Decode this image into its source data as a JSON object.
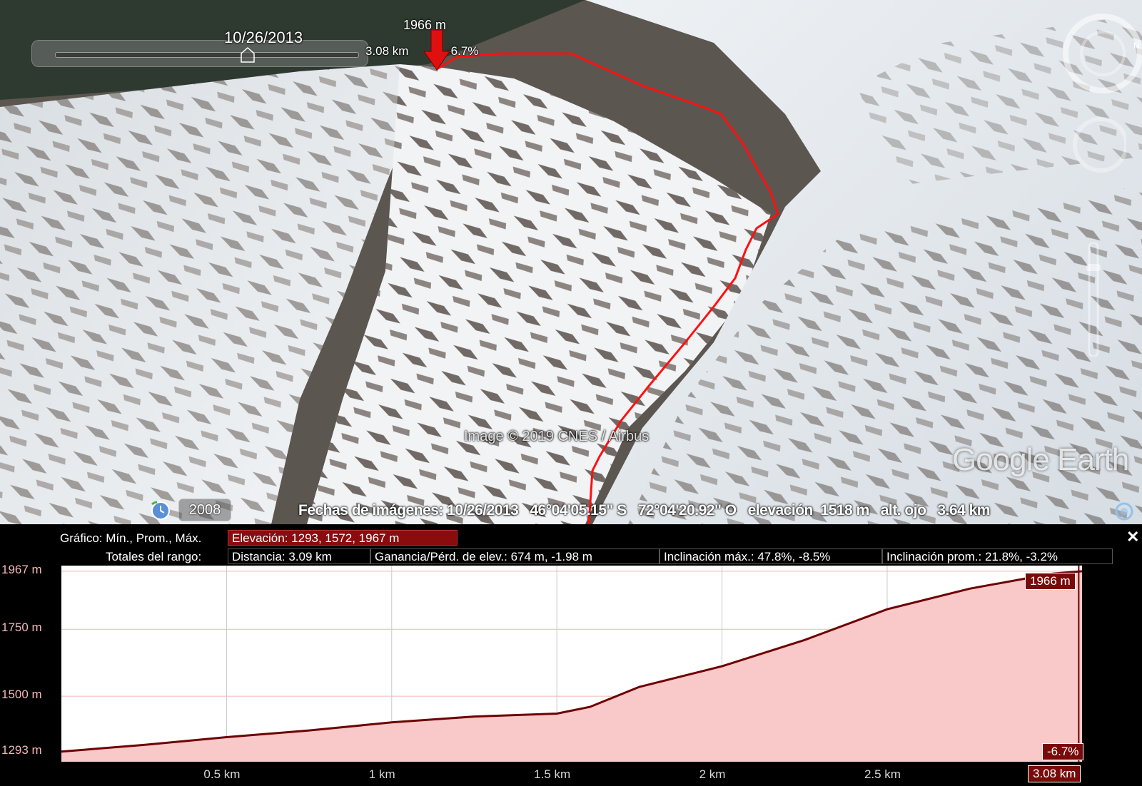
{
  "slider": {
    "date": "10/26/2013"
  },
  "cursor": {
    "elevation": "1966 m",
    "distance": "3.08 km",
    "grade": "-6.7%"
  },
  "map": {
    "credit": "Image © 2019 CNES / Airbus",
    "logo": "Google Earth",
    "history_year": "2008",
    "icons": {
      "history": "history-clock-icon",
      "globe": "globe-icon",
      "compass": "compass-icon",
      "look": "look-joystick-icon",
      "zoom": "zoom-slider-icon"
    }
  },
  "status": {
    "dates": "Fechas de imágenes: 10/26/2013",
    "lat": "46°04'05.15\" S",
    "lon": "72°04'20.92\" O",
    "elevation": "elevación  1518 m",
    "eye": "alt. ojo   3.64 km"
  },
  "profile": {
    "grafico_label": "Gráfico: Mín., Prom., Máx.",
    "elev_summary": "Elevación: 1293, 1572, 1967 m",
    "totales_label": "Totales del rango:",
    "distance": "Distancia: 3.09 km",
    "gain": "Ganancia/Pérd. de elev.: 674 m, -1.98 m",
    "max_slope": "Inclinación máx.: 47.8%, -8.5%",
    "avg_slope": "Inclinación prom.: 21.8%, -3.2%",
    "close": "✕"
  },
  "chart_data": {
    "type": "area",
    "xlabel": "",
    "ylabel": "",
    "y_tick_labels": [
      "1967 m",
      "1750 m",
      "1500 m",
      "1293 m"
    ],
    "y_ticks": [
      1967,
      1750,
      1500,
      1293
    ],
    "x_tick_labels": [
      "0.5 km",
      "1 km",
      "1.5 km",
      "2 km",
      "2.5 km"
    ],
    "x_ticks": [
      0.5,
      1,
      1.5,
      2,
      2.5
    ],
    "xlim": [
      0,
      3.09
    ],
    "ylim": [
      1255,
      1988
    ],
    "x": [
      0,
      0.25,
      0.5,
      0.75,
      1.0,
      1.25,
      1.5,
      1.6,
      1.75,
      2.0,
      2.25,
      2.5,
      2.75,
      3.0,
      3.09
    ],
    "y": [
      1293,
      1318,
      1347,
      1372,
      1402,
      1424,
      1435,
      1460,
      1535,
      1612,
      1710,
      1825,
      1902,
      1958,
      1967
    ],
    "cursor_x": 3.08,
    "colors": {
      "fill": "#f9c8c8",
      "line": "#6d0000",
      "grid": "#f2b3b3"
    }
  }
}
